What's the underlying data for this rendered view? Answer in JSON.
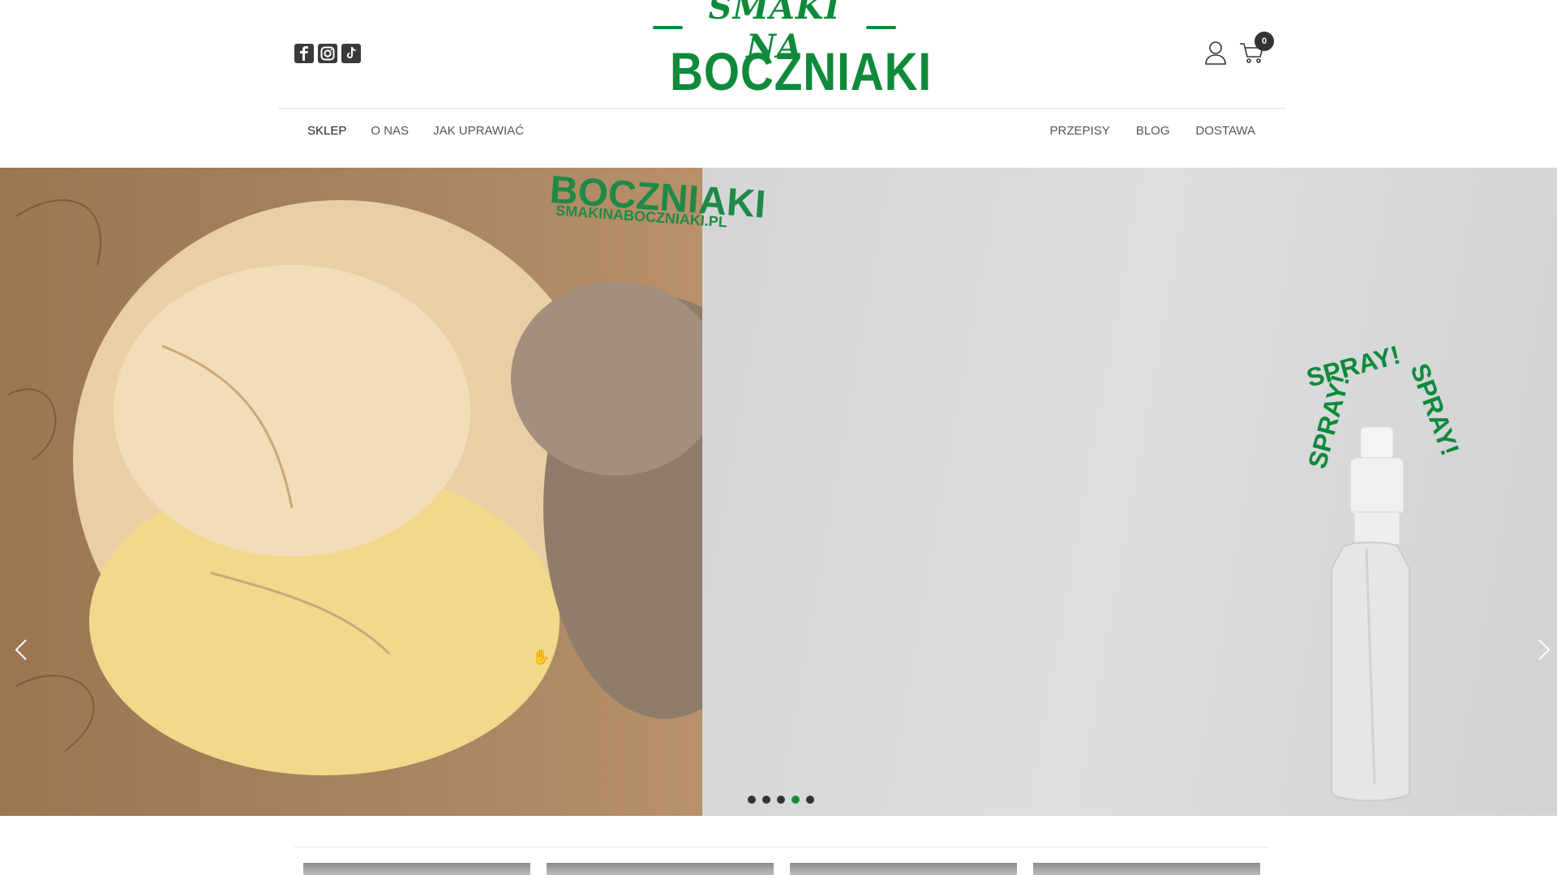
{
  "header": {
    "logo_top": "SMAKI NA",
    "logo_bottom": "BOCZNIAKI",
    "social_icons": [
      "facebook-icon",
      "instagram-icon",
      "tiktok-icon"
    ],
    "cart_count": "0"
  },
  "nav": {
    "left": [
      {
        "label": "SKLEP",
        "active": true
      },
      {
        "label": "O NAS"
      },
      {
        "label": "JAK UPRAWIAĆ"
      }
    ],
    "right": [
      {
        "label": "PRZEPISY"
      },
      {
        "label": "BLOG"
      },
      {
        "label": "DOSTAWA"
      }
    ]
  },
  "hero": {
    "box_text": "BOCZNIAKI",
    "box_url": "SMAKINABOCZNIAKI.PL",
    "spray": [
      "SPRAY!",
      "SPRAY!",
      "SPRAY!"
    ],
    "slides_total": 5,
    "active_slide": 4
  },
  "colors": {
    "brand_green": "#0e8a3a",
    "dot_active": "#1a8a3a",
    "dot_inactive": "#333333"
  }
}
